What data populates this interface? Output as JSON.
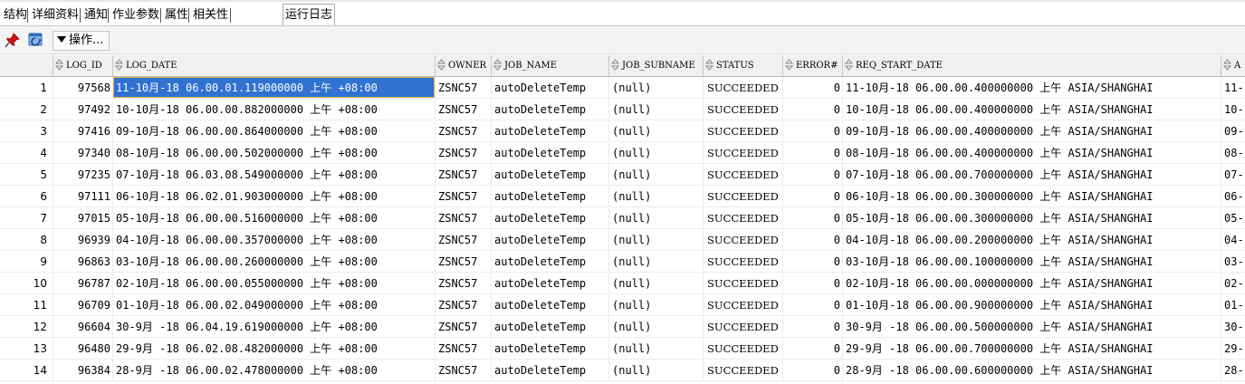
{
  "tabs": [
    "结构",
    "详细资料",
    "通知",
    "作业参数",
    "属性",
    "相关性",
    "运行日志"
  ],
  "active_tab": "运行日志",
  "toolbar": {
    "operations_label": "操作..."
  },
  "columns": [
    "LOG_ID",
    "LOG_DATE",
    "OWNER",
    "JOB_NAME",
    "JOB_SUBNAME",
    "STATUS",
    "ERROR#",
    "REQ_START_DATE",
    "A"
  ],
  "rows": [
    {
      "n": "1",
      "log_id": "97568",
      "log_date": "11-10月-18 06.00.01.119000000 上午 +08:00",
      "owner": "ZSNC57",
      "job_name": "autoDeleteTemp",
      "job_subname": "(null)",
      "status": "SUCCEEDED",
      "error": "0",
      "req_start_date": "11-10月-18 06.00.00.400000000 上午 ASIA/SHANGHAI",
      "a": "11-"
    },
    {
      "n": "2",
      "log_id": "97492",
      "log_date": "10-10月-18 06.00.00.882000000 上午 +08:00",
      "owner": "ZSNC57",
      "job_name": "autoDeleteTemp",
      "job_subname": "(null)",
      "status": "SUCCEEDED",
      "error": "0",
      "req_start_date": "10-10月-18 06.00.00.400000000 上午 ASIA/SHANGHAI",
      "a": "10-"
    },
    {
      "n": "3",
      "log_id": "97416",
      "log_date": "09-10月-18 06.00.00.864000000 上午 +08:00",
      "owner": "ZSNC57",
      "job_name": "autoDeleteTemp",
      "job_subname": "(null)",
      "status": "SUCCEEDED",
      "error": "0",
      "req_start_date": "09-10月-18 06.00.00.400000000 上午 ASIA/SHANGHAI",
      "a": "09-"
    },
    {
      "n": "4",
      "log_id": "97340",
      "log_date": "08-10月-18 06.00.00.502000000 上午 +08:00",
      "owner": "ZSNC57",
      "job_name": "autoDeleteTemp",
      "job_subname": "(null)",
      "status": "SUCCEEDED",
      "error": "0",
      "req_start_date": "08-10月-18 06.00.00.400000000 上午 ASIA/SHANGHAI",
      "a": "08-"
    },
    {
      "n": "5",
      "log_id": "97235",
      "log_date": "07-10月-18 06.03.08.549000000 上午 +08:00",
      "owner": "ZSNC57",
      "job_name": "autoDeleteTemp",
      "job_subname": "(null)",
      "status": "SUCCEEDED",
      "error": "0",
      "req_start_date": "07-10月-18 06.00.00.700000000 上午 ASIA/SHANGHAI",
      "a": "07-"
    },
    {
      "n": "6",
      "log_id": "97111",
      "log_date": "06-10月-18 06.02.01.903000000 上午 +08:00",
      "owner": "ZSNC57",
      "job_name": "autoDeleteTemp",
      "job_subname": "(null)",
      "status": "SUCCEEDED",
      "error": "0",
      "req_start_date": "06-10月-18 06.00.00.300000000 上午 ASIA/SHANGHAI",
      "a": "06-"
    },
    {
      "n": "7",
      "log_id": "97015",
      "log_date": "05-10月-18 06.00.00.516000000 上午 +08:00",
      "owner": "ZSNC57",
      "job_name": "autoDeleteTemp",
      "job_subname": "(null)",
      "status": "SUCCEEDED",
      "error": "0",
      "req_start_date": "05-10月-18 06.00.00.300000000 上午 ASIA/SHANGHAI",
      "a": "05-"
    },
    {
      "n": "8",
      "log_id": "96939",
      "log_date": "04-10月-18 06.00.00.357000000 上午 +08:00",
      "owner": "ZSNC57",
      "job_name": "autoDeleteTemp",
      "job_subname": "(null)",
      "status": "SUCCEEDED",
      "error": "0",
      "req_start_date": "04-10月-18 06.00.00.200000000 上午 ASIA/SHANGHAI",
      "a": "04-"
    },
    {
      "n": "9",
      "log_id": "96863",
      "log_date": "03-10月-18 06.00.00.260000000 上午 +08:00",
      "owner": "ZSNC57",
      "job_name": "autoDeleteTemp",
      "job_subname": "(null)",
      "status": "SUCCEEDED",
      "error": "0",
      "req_start_date": "03-10月-18 06.00.00.100000000 上午 ASIA/SHANGHAI",
      "a": "03-"
    },
    {
      "n": "10",
      "log_id": "96787",
      "log_date": "02-10月-18 06.00.00.055000000 上午 +08:00",
      "owner": "ZSNC57",
      "job_name": "autoDeleteTemp",
      "job_subname": "(null)",
      "status": "SUCCEEDED",
      "error": "0",
      "req_start_date": "02-10月-18 06.00.00.000000000 上午 ASIA/SHANGHAI",
      "a": "02-"
    },
    {
      "n": "11",
      "log_id": "96709",
      "log_date": "01-10月-18 06.00.02.049000000 上午 +08:00",
      "owner": "ZSNC57",
      "job_name": "autoDeleteTemp",
      "job_subname": "(null)",
      "status": "SUCCEEDED",
      "error": "0",
      "req_start_date": "01-10月-18 06.00.00.900000000 上午 ASIA/SHANGHAI",
      "a": "01-"
    },
    {
      "n": "12",
      "log_id": "96604",
      "log_date": "30-9月 -18 06.04.19.619000000 上午 +08:00",
      "owner": "ZSNC57",
      "job_name": "autoDeleteTemp",
      "job_subname": "(null)",
      "status": "SUCCEEDED",
      "error": "0",
      "req_start_date": "30-9月 -18 06.00.00.500000000 上午 ASIA/SHANGHAI",
      "a": "30-"
    },
    {
      "n": "13",
      "log_id": "96480",
      "log_date": "29-9月 -18 06.02.08.482000000 上午 +08:00",
      "owner": "ZSNC57",
      "job_name": "autoDeleteTemp",
      "job_subname": "(null)",
      "status": "SUCCEEDED",
      "error": "0",
      "req_start_date": "29-9月 -18 06.00.00.700000000 上午 ASIA/SHANGHAI",
      "a": "29-"
    },
    {
      "n": "14",
      "log_id": "96384",
      "log_date": "28-9月 -18 06.00.02.478000000 上午 +08:00",
      "owner": "ZSNC57",
      "job_name": "autoDeleteTemp",
      "job_subname": "(null)",
      "status": "SUCCEEDED",
      "error": "0",
      "req_start_date": "28-9月 -18 06.00.00.600000000 上午 ASIA/SHANGHAI",
      "a": "28-"
    }
  ],
  "selected_cell": {
    "row": 0,
    "column": "LOG_DATE"
  },
  "colors": {
    "selection": "#2f72d1",
    "header_bg": "#f0f0f0"
  }
}
